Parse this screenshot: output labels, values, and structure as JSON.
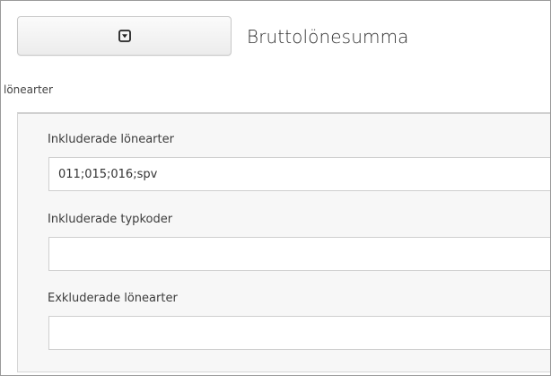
{
  "header": {
    "toggle_icon": "caret-down-box-icon",
    "title": "Bruttolönesumma"
  },
  "group": {
    "label": "lönearter"
  },
  "fields": [
    {
      "label": "Inkluderade lönearter",
      "value": "011;015;016;spv"
    },
    {
      "label": "Inkluderade typkoder",
      "value": ""
    },
    {
      "label": "Exkluderade lönearter",
      "value": ""
    }
  ],
  "colors": {
    "frame_border": "#9a9a9a",
    "panel_background": "#f7f7f7",
    "input_border": "#cfcfcf"
  }
}
